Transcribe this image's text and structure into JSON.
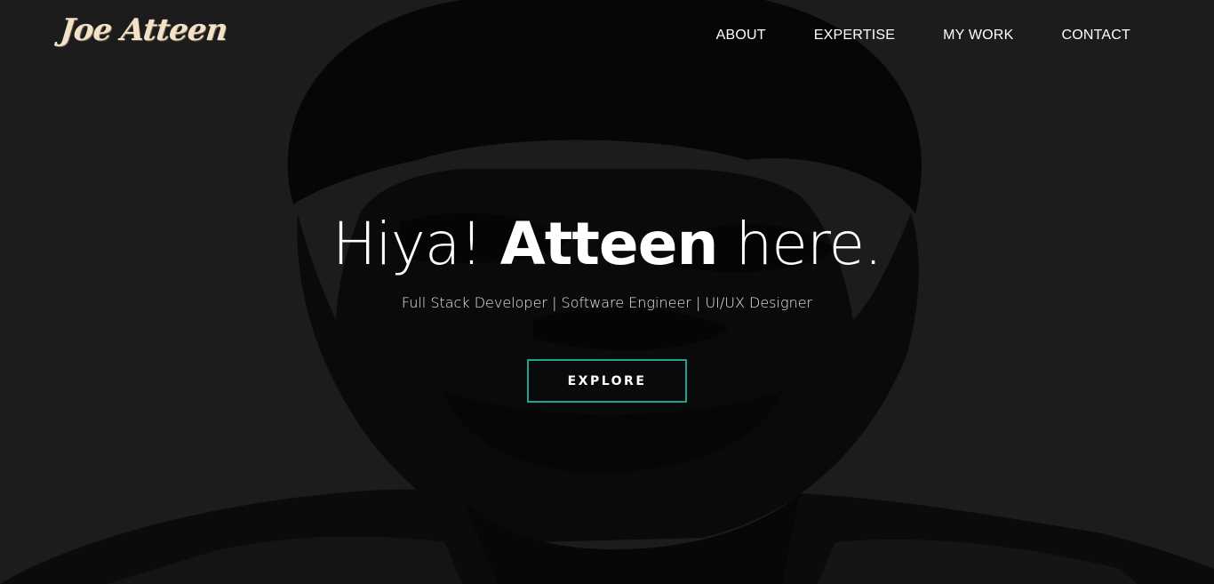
{
  "brand": {
    "logo_text": "Joe Atteen"
  },
  "nav": {
    "items": [
      {
        "label": "ABOUT"
      },
      {
        "label": "EXPERTISE"
      },
      {
        "label": "MY WORK"
      },
      {
        "label": "CONTACT"
      }
    ]
  },
  "hero": {
    "headline_prefix": "Hiya!",
    "headline_name": "Atteen",
    "headline_suffix": "here.",
    "subtitle": "Full Stack Developer | Software Engineer | UI/UX Designer",
    "cta_label": "EXPLORE"
  },
  "colors": {
    "background": "#1c1c1d",
    "figure": "#060606",
    "logo": "#f3e2c8",
    "accent": "#24a08c",
    "text": "#ffffff"
  }
}
